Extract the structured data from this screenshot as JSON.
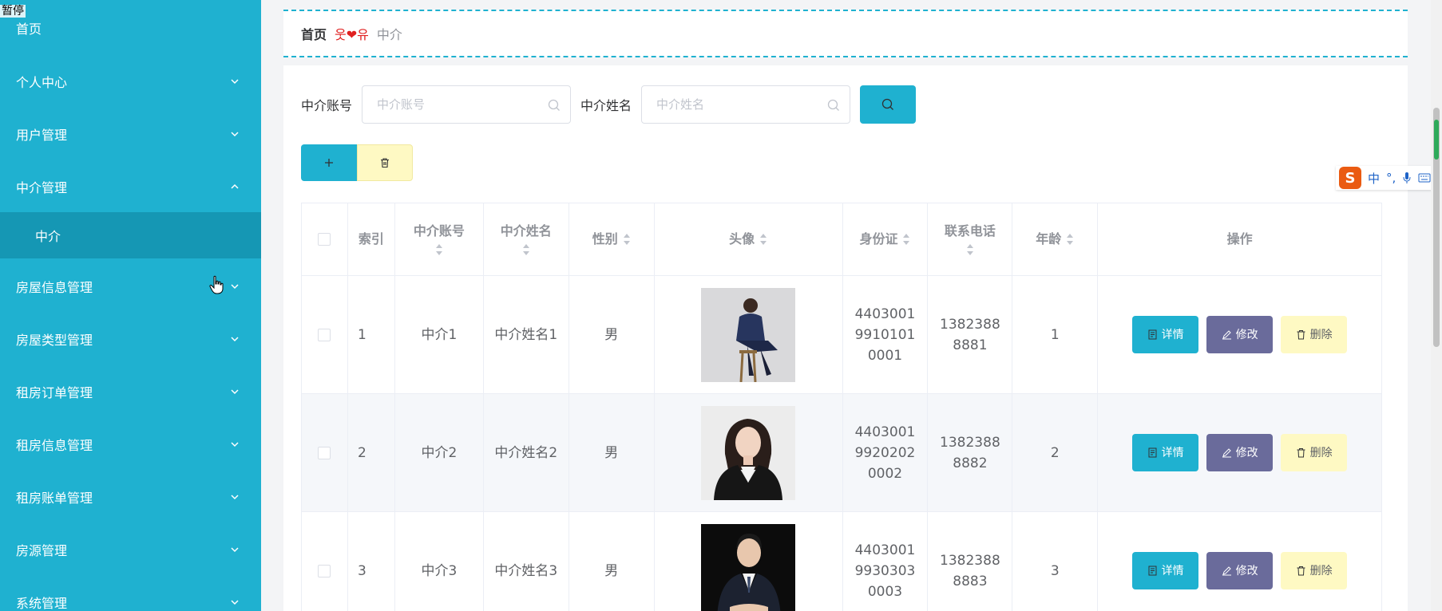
{
  "overlay_label": "暂停",
  "sidebar": {
    "items": [
      {
        "label": "首页",
        "expandable": false
      },
      {
        "label": "个人中心",
        "expandable": true
      },
      {
        "label": "用户管理",
        "expandable": true
      },
      {
        "label": "中介管理",
        "expandable": true,
        "expanded": true
      },
      {
        "label": "中介",
        "sub": true
      },
      {
        "label": "房屋信息管理",
        "expandable": true
      },
      {
        "label": "房屋类型管理",
        "expandable": true
      },
      {
        "label": "租房订单管理",
        "expandable": true
      },
      {
        "label": "租房信息管理",
        "expandable": true
      },
      {
        "label": "租房账单管理",
        "expandable": true
      },
      {
        "label": "房源管理",
        "expandable": true
      },
      {
        "label": "系统管理",
        "expandable": true
      }
    ],
    "bg_color": "#1fb1d0",
    "active_sub_color": "#1597b4"
  },
  "breadcrumb": {
    "home": "首页",
    "separator": "웃❤유",
    "current": "中介"
  },
  "search": {
    "account_label": "中介账号",
    "account_placeholder": "中介账号",
    "name_label": "中介姓名",
    "name_placeholder": "中介姓名"
  },
  "table": {
    "headers": {
      "index": "索引",
      "account": "中介账号",
      "name": "中介姓名",
      "gender": "性别",
      "avatar": "头像",
      "id_card": "身份证",
      "phone": "联系电话",
      "age": "年龄",
      "ops": "操作"
    },
    "rows": [
      {
        "index": "1",
        "account": "中介1",
        "name": "中介姓名1",
        "gender": "男",
        "id_card": "440300199101010001",
        "phone": "13823888881",
        "age": "1"
      },
      {
        "index": "2",
        "account": "中介2",
        "name": "中介姓名2",
        "gender": "男",
        "id_card": "440300199202020002",
        "phone": "13823888882",
        "age": "2"
      },
      {
        "index": "3",
        "account": "中介3",
        "name": "中介姓名3",
        "gender": "男",
        "id_card": "440300199303030003",
        "phone": "13823888883",
        "age": "3"
      }
    ],
    "ops_labels": {
      "detail": "详情",
      "edit": "修改",
      "delete": "删除"
    }
  },
  "ime": {
    "logo": "S",
    "mode": "中",
    "punct": "°,"
  },
  "colors": {
    "primary": "#1fb1d0",
    "edit": "#6a6b9b",
    "delete_bg": "#fef9c3"
  }
}
